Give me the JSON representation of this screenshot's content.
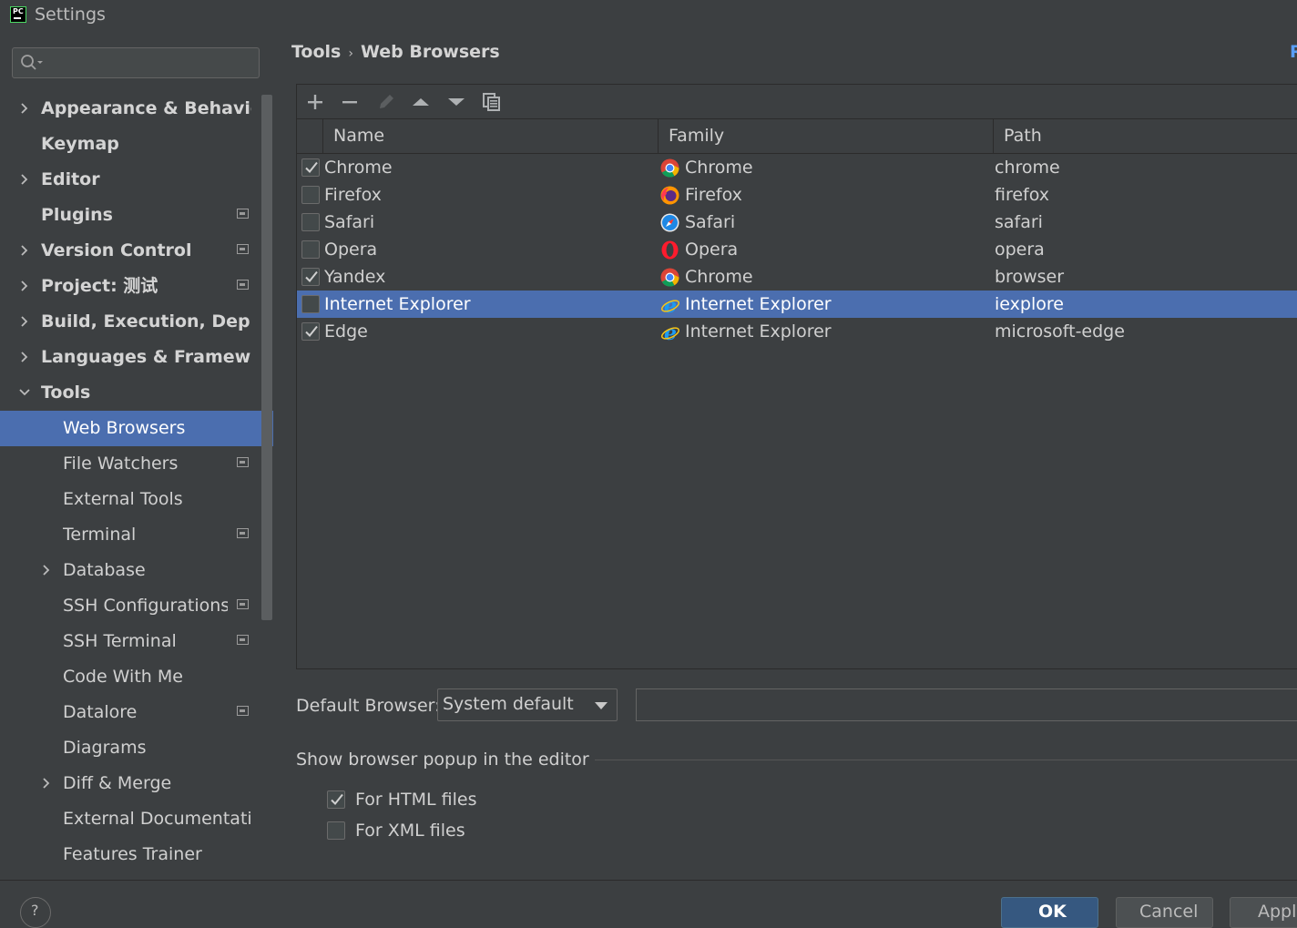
{
  "window": {
    "title": "Settings"
  },
  "sidebar": {
    "search": {
      "value": "",
      "placeholder": ""
    },
    "items": [
      {
        "label": "Appearance & Behavior",
        "level": 0,
        "expandable": true,
        "expanded": false,
        "bold": true,
        "project_icon": false
      },
      {
        "label": "Keymap",
        "level": 0,
        "expandable": false,
        "bold": true,
        "project_icon": false
      },
      {
        "label": "Editor",
        "level": 0,
        "expandable": true,
        "expanded": false,
        "bold": true,
        "project_icon": false
      },
      {
        "label": "Plugins",
        "level": 0,
        "expandable": false,
        "bold": true,
        "project_icon": true
      },
      {
        "label": "Version Control",
        "level": 0,
        "expandable": true,
        "expanded": false,
        "bold": true,
        "project_icon": true
      },
      {
        "label": "Project: 测试",
        "level": 0,
        "expandable": true,
        "expanded": false,
        "bold": true,
        "project_icon": true
      },
      {
        "label": "Build, Execution, Deploym",
        "level": 0,
        "expandable": true,
        "expanded": false,
        "bold": true,
        "project_icon": false
      },
      {
        "label": "Languages & Frameworks",
        "level": 0,
        "expandable": true,
        "expanded": false,
        "bold": true,
        "project_icon": false
      },
      {
        "label": "Tools",
        "level": 0,
        "expandable": true,
        "expanded": true,
        "bold": true,
        "project_icon": false
      },
      {
        "label": "Web Browsers",
        "level": 1,
        "expandable": false,
        "bold": false,
        "project_icon": false,
        "selected": true
      },
      {
        "label": "File Watchers",
        "level": 1,
        "expandable": false,
        "bold": false,
        "project_icon": true
      },
      {
        "label": "External Tools",
        "level": 1,
        "expandable": false,
        "bold": false,
        "project_icon": false
      },
      {
        "label": "Terminal",
        "level": 1,
        "expandable": false,
        "bold": false,
        "project_icon": true
      },
      {
        "label": "Database",
        "level": 1,
        "expandable": true,
        "expanded": false,
        "bold": false,
        "project_icon": false
      },
      {
        "label": "SSH Configurations",
        "level": 1,
        "expandable": false,
        "bold": false,
        "project_icon": true
      },
      {
        "label": "SSH Terminal",
        "level": 1,
        "expandable": false,
        "bold": false,
        "project_icon": true
      },
      {
        "label": "Code With Me",
        "level": 1,
        "expandable": false,
        "bold": false,
        "project_icon": false
      },
      {
        "label": "Datalore",
        "level": 1,
        "expandable": false,
        "bold": false,
        "project_icon": true
      },
      {
        "label": "Diagrams",
        "level": 1,
        "expandable": false,
        "bold": false,
        "project_icon": false
      },
      {
        "label": "Diff & Merge",
        "level": 1,
        "expandable": true,
        "expanded": false,
        "bold": false,
        "project_icon": false
      },
      {
        "label": "External Documentation",
        "level": 1,
        "expandable": false,
        "bold": false,
        "project_icon": false
      },
      {
        "label": "Features Trainer",
        "level": 1,
        "expandable": false,
        "bold": false,
        "project_icon": false
      }
    ]
  },
  "breadcrumb": {
    "parent": "Tools",
    "separator": "›",
    "current": "Web Browsers"
  },
  "reset_label": "R",
  "toolbar": {
    "buttons": [
      {
        "icon": "plus-icon",
        "enabled": true
      },
      {
        "icon": "minus-icon",
        "enabled": true
      },
      {
        "icon": "pencil-icon",
        "enabled": false
      },
      {
        "icon": "arrow-up-icon",
        "enabled": true
      },
      {
        "icon": "arrow-down-icon",
        "enabled": true
      },
      {
        "icon": "copy-icon",
        "enabled": true
      }
    ]
  },
  "table": {
    "columns": [
      "Name",
      "Family",
      "Path"
    ],
    "rows": [
      {
        "checked": true,
        "name": "Chrome",
        "family": "Chrome",
        "family_icon": "chrome-icon",
        "path": "chrome",
        "selected": false
      },
      {
        "checked": false,
        "name": "Firefox",
        "family": "Firefox",
        "family_icon": "firefox-icon",
        "path": "firefox",
        "selected": false
      },
      {
        "checked": false,
        "name": "Safari",
        "family": "Safari",
        "family_icon": "safari-icon",
        "path": "safari",
        "selected": false
      },
      {
        "checked": false,
        "name": "Opera",
        "family": "Opera",
        "family_icon": "opera-icon",
        "path": "opera",
        "selected": false
      },
      {
        "checked": true,
        "name": "Yandex",
        "family": "Chrome",
        "family_icon": "chrome-icon",
        "path": "browser",
        "selected": false
      },
      {
        "checked": false,
        "name": "Internet Explorer",
        "family": "Internet Explorer",
        "family_icon": "ie-icon",
        "path": "iexplore",
        "selected": true
      },
      {
        "checked": true,
        "name": "Edge",
        "family": "Internet Explorer",
        "family_icon": "ie-icon",
        "path": "microsoft-edge",
        "selected": false
      }
    ]
  },
  "default_browser": {
    "label": "Default Browser:",
    "value": "System default",
    "path_value": ""
  },
  "popup_section": {
    "title": "Show browser popup in the editor",
    "options": [
      {
        "label": "For HTML files",
        "checked": true
      },
      {
        "label": "For XML files",
        "checked": false
      }
    ]
  },
  "buttons": {
    "help": "?",
    "ok": "OK",
    "cancel": "Cancel",
    "apply": "Apply"
  },
  "colors": {
    "background": "#3c3f41",
    "selection": "#4b6eaf",
    "accent": "#589df6",
    "ok_button": "#365880"
  }
}
